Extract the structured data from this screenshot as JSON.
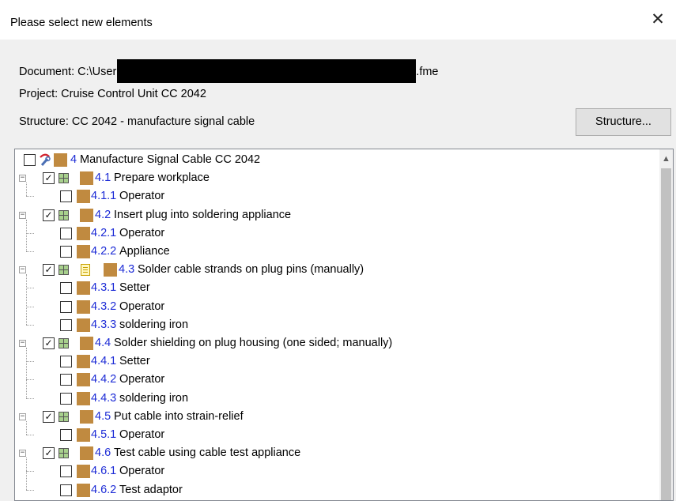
{
  "dialog": {
    "title": "Please select new elements",
    "close_glyph": "✕"
  },
  "info": {
    "document_prefix": "Document: C:\\User",
    "document_suffix": ".fme",
    "project": "Project: Cruise Control Unit CC 2042",
    "structure": "Structure: CC 2042 - manufacture signal cable",
    "structure_button": "Structure..."
  },
  "tree": {
    "root": {
      "num": "4",
      "label": "Manufacture Signal Cable CC 2042",
      "checked": false,
      "icon": "tool-wrench-icon"
    },
    "items": [
      {
        "num": "4.1",
        "label": "Prepare workplace",
        "checked": true,
        "icons": [
          "grid"
        ],
        "children": [
          {
            "num": "4.1.1",
            "label": "Operator",
            "checked": false
          }
        ]
      },
      {
        "num": "4.2",
        "label": "Insert plug into soldering appliance",
        "checked": true,
        "icons": [
          "grid"
        ],
        "children": [
          {
            "num": "4.2.1",
            "label": "Operator",
            "checked": false
          },
          {
            "num": "4.2.2",
            "label": "Appliance",
            "checked": false
          }
        ]
      },
      {
        "num": "4.3",
        "label": "Solder cable strands on plug pins (manually)",
        "checked": true,
        "icons": [
          "grid",
          "doc"
        ],
        "children": [
          {
            "num": "4.3.1",
            "label": "Setter",
            "checked": false
          },
          {
            "num": "4.3.2",
            "label": "Operator",
            "checked": false
          },
          {
            "num": "4.3.3",
            "label": "soldering iron",
            "checked": false
          }
        ]
      },
      {
        "num": "4.4",
        "label": "Solder shielding on plug housing (one sided; manually)",
        "checked": true,
        "icons": [
          "grid"
        ],
        "children": [
          {
            "num": "4.4.1",
            "label": "Setter",
            "checked": false
          },
          {
            "num": "4.4.2",
            "label": "Operator",
            "checked": false
          },
          {
            "num": "4.4.3",
            "label": "soldering iron",
            "checked": false
          }
        ]
      },
      {
        "num": "4.5",
        "label": "Put cable into strain-relief",
        "checked": true,
        "icons": [
          "grid"
        ],
        "children": [
          {
            "num": "4.5.1",
            "label": "Operator",
            "checked": false
          }
        ]
      },
      {
        "num": "4.6",
        "label": "Test cable using cable test appliance",
        "checked": true,
        "icons": [
          "grid"
        ],
        "children": [
          {
            "num": "4.6.1",
            "label": "Operator",
            "checked": false
          },
          {
            "num": "4.6.2",
            "label": "Test adaptor",
            "checked": false
          }
        ]
      }
    ]
  },
  "colors": {
    "number_link": "#1c2bd6",
    "element_square": "#c08a40",
    "panel_bg": "#f0f0f0"
  }
}
